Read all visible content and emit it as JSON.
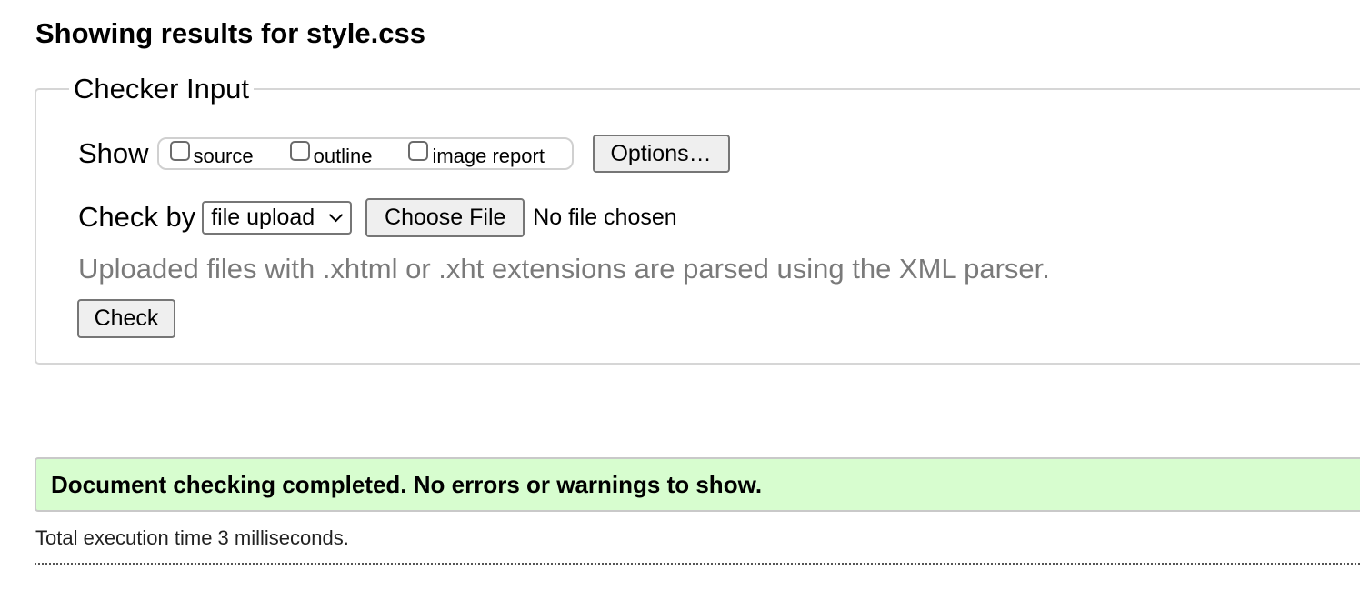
{
  "heading": "Showing results for style.css",
  "checker": {
    "legend": "Checker Input",
    "show_label": "Show",
    "show_options": [
      {
        "label": "source",
        "checked": false
      },
      {
        "label": "outline",
        "checked": false
      },
      {
        "label": "image report",
        "checked": false
      }
    ],
    "options_button": "Options…",
    "check_by_label": "Check by",
    "check_by_selected": "file upload",
    "choose_file_button": "Choose File",
    "no_file_text": "No file chosen",
    "hint": "Uploaded files with .xhtml or .xht extensions are parsed using the XML parser.",
    "check_button": "Check"
  },
  "result": {
    "message": "Document checking completed. No errors or warnings to show.",
    "status_color": "#d7fdcf"
  },
  "footer": {
    "execution_time": "Total execution time 3 milliseconds."
  },
  "icons": {
    "select_chevron": "chevron-down-icon"
  }
}
